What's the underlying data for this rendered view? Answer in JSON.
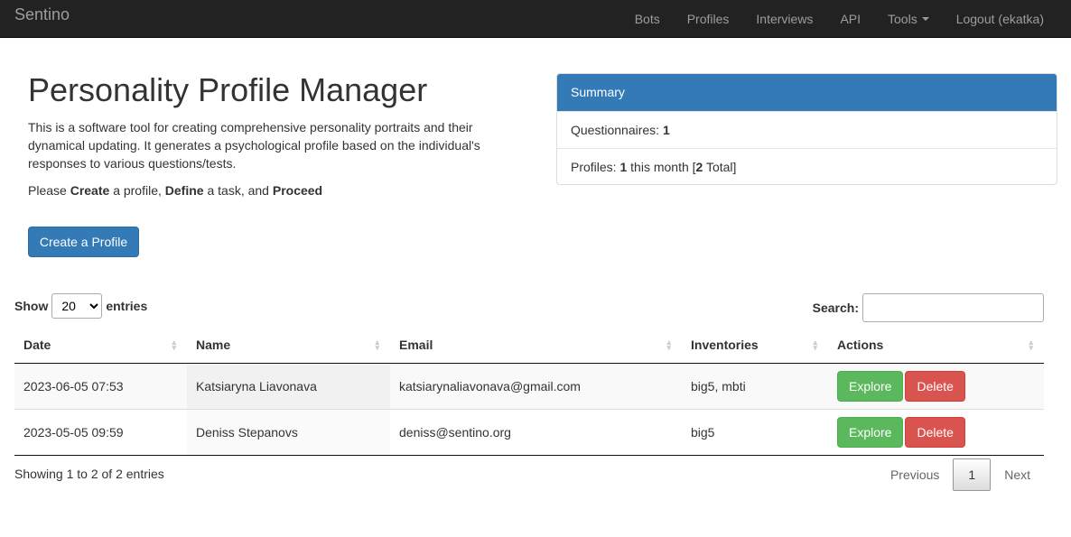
{
  "navbar": {
    "brand": "Sentino",
    "links": [
      "Bots",
      "Profiles",
      "Interviews",
      "API"
    ],
    "tools_label": "Tools",
    "logout_label": "Logout (ekatka)"
  },
  "hero": {
    "title": "Personality Profile Manager",
    "description": "This is a software tool for creating comprehensive personality portraits and their dynamical updating. It generates a psychological profile based on the individual's responses to various questions/tests.",
    "steps": {
      "please": "Please",
      "create": "Create",
      "after_create": "a profile,",
      "define": "Define",
      "after_define": "a task, and",
      "proceed": "Proceed"
    },
    "create_button": "Create a Profile"
  },
  "summary": {
    "heading": "Summary",
    "questionnaires_label": "Questionnaires:",
    "questionnaires_count": "1",
    "profiles_label": "Profiles:",
    "profiles_month": "1",
    "profiles_month_text": "this month [",
    "profiles_total": "2",
    "profiles_total_text": "Total]"
  },
  "table_controls": {
    "show_label": "Show",
    "entries_label": "entries",
    "page_length": "20",
    "search_label": "Search:",
    "search_value": ""
  },
  "table": {
    "columns": [
      "Date",
      "Name",
      "Email",
      "Inventories",
      "Actions"
    ],
    "rows": [
      {
        "date": "2023-06-05 07:53",
        "name": "Katsiaryna Liavonava",
        "email": "katsiarynaliavonava@gmail.com",
        "inventories": "big5, mbti",
        "explore": "Explore",
        "delete": "Delete"
      },
      {
        "date": "2023-05-05 09:59",
        "name": "Deniss Stepanovs",
        "email": "deniss@sentino.org",
        "inventories": "big5",
        "explore": "Explore",
        "delete": "Delete"
      }
    ]
  },
  "footer": {
    "info": "Showing 1 to 2 of 2 entries",
    "previous": "Previous",
    "page": "1",
    "next": "Next"
  },
  "colors": {
    "navbar_bg": "#222222",
    "primary": "#337ab7",
    "success": "#5cb85c",
    "danger": "#d9534f"
  },
  "icons": {
    "tools_dropdown": "caret-down-icon",
    "column_sort": "sort-both-icon"
  }
}
